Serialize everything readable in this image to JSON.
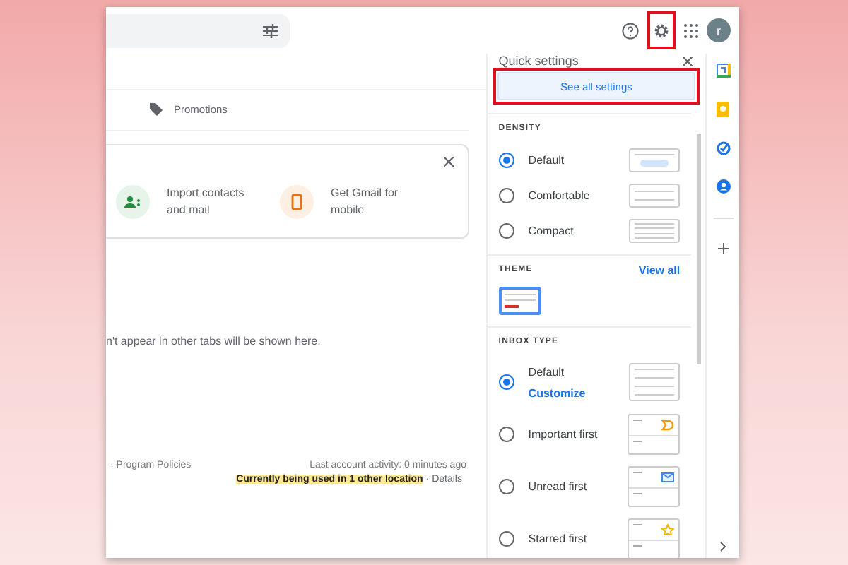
{
  "header": {
    "avatar_letter": "r"
  },
  "main": {
    "tabs": [
      {
        "label": "Promotions",
        "selected": false
      }
    ],
    "setup_card": {
      "items": [
        {
          "kind": "contacts",
          "label": "Import contacts and mail"
        },
        {
          "kind": "mobile",
          "label": "Get Gmail for mobile"
        }
      ]
    },
    "empty_message": "n't appear in other tabs will be shown here.",
    "footer": {
      "policies": "· Program Policies",
      "activity": "Last account activity: 0 minutes ago",
      "location_notice": "Currently being used in 1 other location",
      "details": "· Details"
    }
  },
  "quick_settings": {
    "title": "Quick settings",
    "button": "See all settings",
    "density": {
      "heading": "DENSITY",
      "options": [
        {
          "label": "Default",
          "kind": "default",
          "selected": true
        },
        {
          "label": "Comfortable",
          "kind": "comfortable",
          "selected": false
        },
        {
          "label": "Compact",
          "kind": "compact",
          "selected": false
        }
      ]
    },
    "theme": {
      "heading": "THEME",
      "link": "View all"
    },
    "inbox_type": {
      "heading": "INBOX TYPE",
      "options": [
        {
          "label": "Default",
          "kind": "default",
          "selected": true,
          "link": "Customize"
        },
        {
          "label": "Important first",
          "kind": "important",
          "selected": false
        },
        {
          "label": "Unread first",
          "kind": "unread",
          "selected": false
        },
        {
          "label": "Starred first",
          "kind": "starred",
          "selected": false
        }
      ]
    }
  }
}
